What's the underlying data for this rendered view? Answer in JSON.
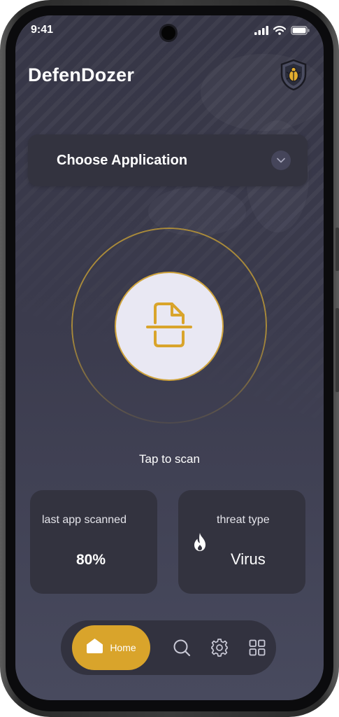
{
  "status_bar": {
    "time": "9:41"
  },
  "app": {
    "title": "DefenDozer"
  },
  "chooser": {
    "label": "Choose Application"
  },
  "scan": {
    "label": "Tap to scan"
  },
  "stats": {
    "last_scanned": {
      "label": "last app scanned",
      "value": "80%"
    },
    "threat": {
      "label": "threat type",
      "value": "Virus"
    }
  },
  "nav": {
    "home_label": "Home"
  },
  "colors": {
    "accent": "#d9a42b",
    "card": "#33333f",
    "background_top": "#363646",
    "background_bottom": "#484a5e",
    "scan_button": "#e9e8f3"
  },
  "icons": {
    "status": [
      "signal-icon",
      "wifi-icon",
      "battery-icon"
    ],
    "header": "shield-bug-icon",
    "chooser": "chevron-down-icon",
    "scan": "document-scan-icon",
    "threat": "flame-icon",
    "nav": [
      "home-icon",
      "search-icon",
      "gear-icon",
      "grid-icon"
    ]
  }
}
